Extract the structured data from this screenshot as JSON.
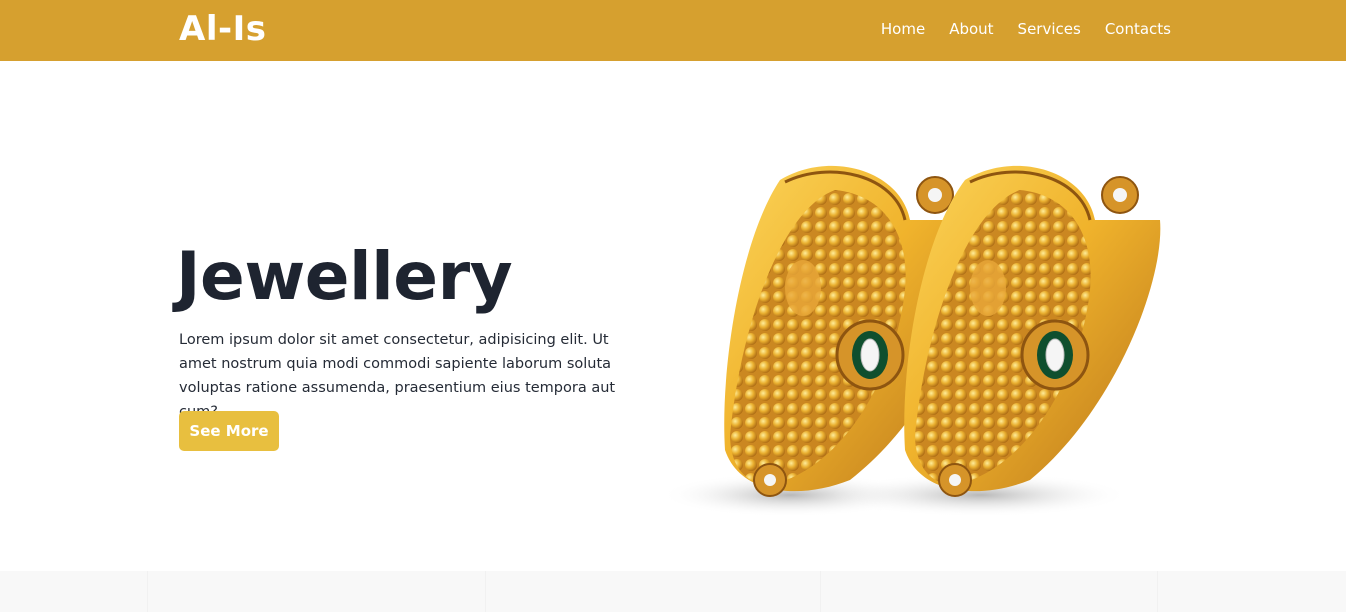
{
  "header": {
    "brand": "Al-Is",
    "nav": [
      {
        "label": "Home"
      },
      {
        "label": "About"
      },
      {
        "label": "Services"
      },
      {
        "label": "Contacts"
      }
    ]
  },
  "hero": {
    "title": "Jewellery",
    "text": "Lorem ipsum dolor sit amet consectetur, adipisicing elit. Ut amet nostrum quia modi commodi sapiente laborum soluta voluptas ratione assumenda, praesentium eius tempora aut cum?",
    "button_label": "See More",
    "image_icon": "gold-bangles-image"
  },
  "colors": {
    "header_bg": "#d6a02f",
    "button_bg": "#e8bf3f",
    "title": "#1e2430",
    "gold_light": "#f7c23c",
    "gold_dark": "#b8741a"
  }
}
